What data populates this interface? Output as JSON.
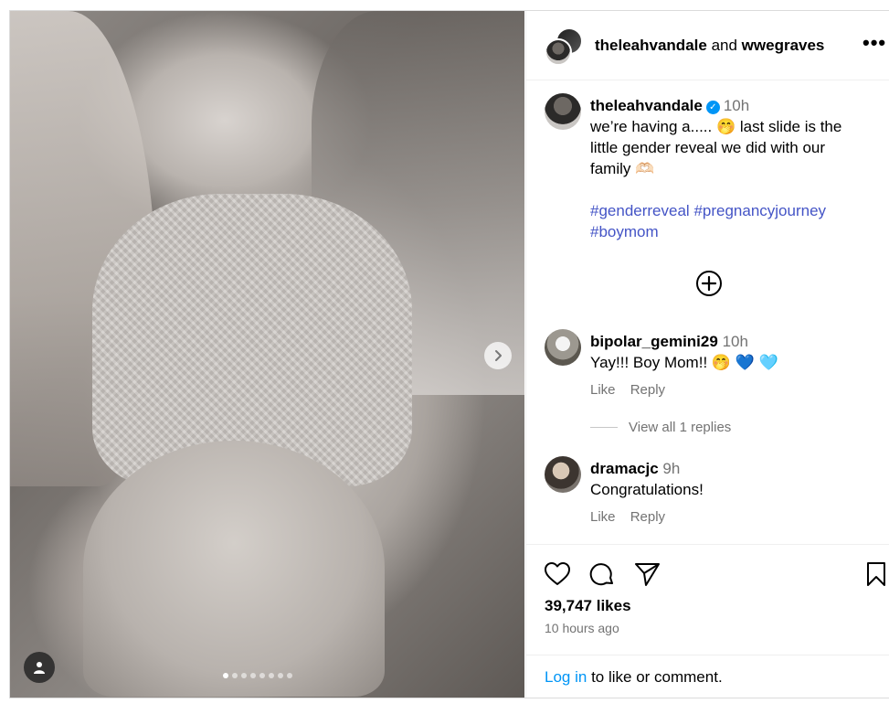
{
  "post": {
    "authors": {
      "primary": "theleahvandale",
      "joiner": "and",
      "secondary": "wwegraves"
    },
    "more_label": "•••",
    "caption": {
      "username": "theleahvandale",
      "time": "10h",
      "text_part1": "we’re having a..... 🤭 last slide is the little gender reveal we did with our family 🫶🏻",
      "hashtags": [
        "#genderreveal",
        "#pregnancyjourney",
        "#boymom"
      ]
    },
    "comments": [
      {
        "username": "bipolar_gemini29",
        "time": "10h",
        "text": "Yay!!! Boy Mom!! 🤭 💙 🩵",
        "like_label": "Like",
        "reply_label": "Reply",
        "view_replies": "View all 1 replies"
      },
      {
        "username": "dramacjc",
        "time": "9h",
        "text": "Congratulations!",
        "like_label": "Like",
        "reply_label": "Reply"
      }
    ],
    "likes": "39,747 likes",
    "time_ago": "10 hours ago",
    "login": {
      "link": "Log in",
      "rest": "to like or comment."
    },
    "carousel": {
      "count": 8,
      "active_index": 0
    }
  }
}
